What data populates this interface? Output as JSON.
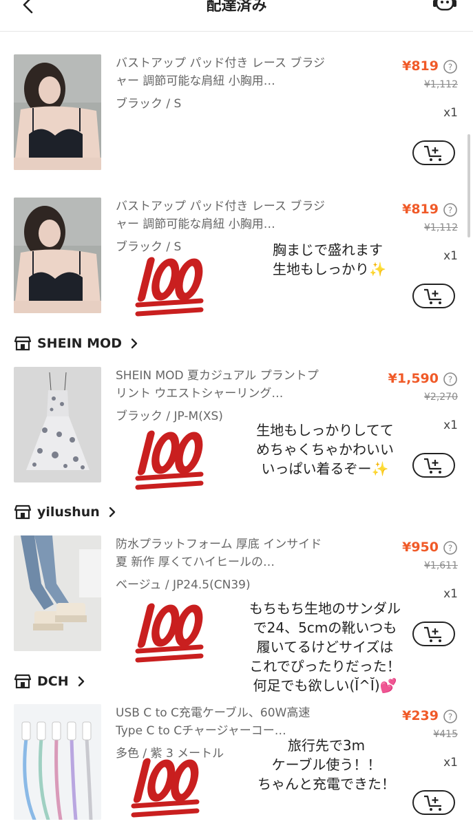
{
  "header": {
    "title": "配達済み"
  },
  "items": [
    {
      "name": "バストアップ パッド付き レース ブラジャー 調節可能な肩紐 小胸用…",
      "variant": "ブラック / S",
      "price": "¥819",
      "original_price": "¥1,112",
      "qty": "x1"
    },
    {
      "name": "バストアップ パッド付き レース ブラジャー 調節可能な肩紐 小胸用…",
      "variant": "ブラック / S",
      "price": "¥819",
      "original_price": "¥1,112",
      "qty": "x1",
      "note_lines": [
        "胸まじで盛れます",
        "生地もしっかり✨"
      ]
    },
    {
      "name": "SHEIN MOD 夏カジュアル プラントプリント ウエストシャーリング…",
      "variant": "ブラック / JP-M(XS)",
      "price": "¥1,590",
      "original_price": "¥2,270",
      "qty": "x1",
      "note_lines": [
        "生地もしっかりしてて",
        "めちゃくちゃかわいい",
        "いっぱい着るぞー✨"
      ]
    },
    {
      "name": "防水プラットフォーム 厚底 インサイド 夏 新作 厚くてハイヒールの…",
      "variant": "ベージュ / JP24.5(CN39)",
      "price": "¥950",
      "original_price": "¥1,611",
      "qty": "x1",
      "note_lines": [
        "もちもち生地のサンダル",
        "で24、5cmの靴いつも",
        "履いてるけどサイズは",
        "これでぴったりだった！",
        "何足でも欲しい(Ĭ^Ĭ)💕"
      ]
    },
    {
      "name": "USB C to C充電ケーブル、60W高速 Type C to Cチャージャーコー…",
      "variant": "多色 / 紫 3 メートル",
      "price": "¥239",
      "original_price": "¥415",
      "qty": "x1",
      "note_lines": [
        "旅行先で3m",
        "ケーブル使う！！",
        "ちゃんと充電できた！"
      ]
    }
  ],
  "stores": [
    {
      "name": "SHEIN MOD"
    },
    {
      "name": "yilushun"
    },
    {
      "name": "DCH"
    }
  ],
  "sticker": {
    "emoji_name": "hundred-points-emoji",
    "color": "#c91f1f"
  },
  "colors": {
    "accent": "#f05a28",
    "muted": "#8a8a8a",
    "text": "#222222"
  }
}
